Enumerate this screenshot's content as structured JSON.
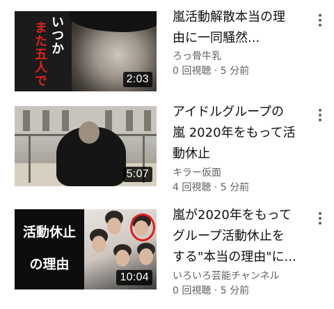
{
  "videos": [
    {
      "thumb_text": [
        "いつか",
        "また五人で"
      ],
      "duration": "2:03",
      "title_lines": [
        "嵐活動解散本当の理",
        "由に一同騒然..."
      ],
      "channel": "ろっ骨牛乳",
      "meta": "0 回視聴 · 5 分前"
    },
    {
      "duration": "5:07",
      "title_lines": [
        "アイドルグループの",
        "嵐 2020年をもって活",
        "動休止"
      ],
      "channel": "キラー仮面",
      "meta": "4 回視聴 · 5 分前"
    },
    {
      "thumb_text": [
        "活動休止",
        "の理由"
      ],
      "duration": "10:04",
      "title_lines": [
        "嵐が2020年をもって",
        "グループ活動休止を",
        "する\"本当の理由\"に..."
      ],
      "channel": "いろいろ芸能チャンネル",
      "meta": "0 回視聴 · 5 分前"
    }
  ],
  "colors": {
    "text": "#0f0f0f",
    "secondary": "#606060",
    "thumb_red": "#e01b1b"
  },
  "icons": {
    "more": "more-vert-icon"
  }
}
